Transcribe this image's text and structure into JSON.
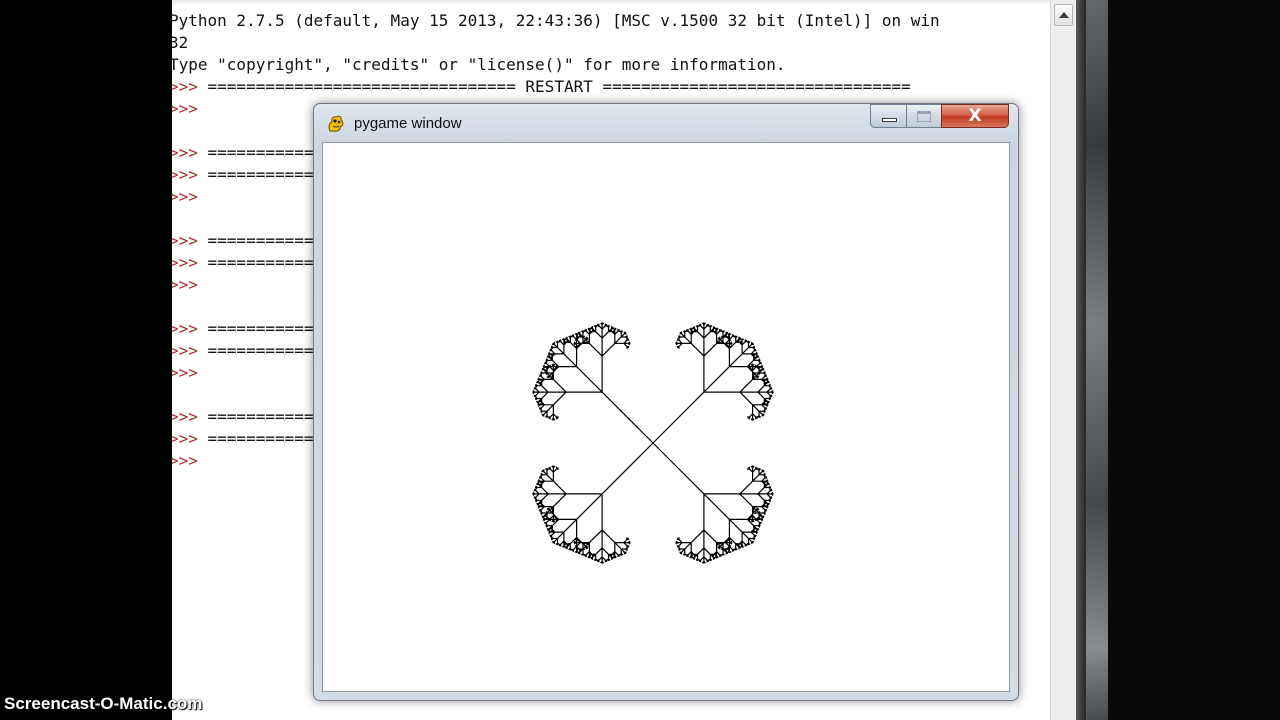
{
  "shell": {
    "lines": [
      {
        "kind": "out",
        "text": "Python 2.7.5 (default, May 15 2013, 22:43:36) [MSC v.1500 32 bit (Intel)] on win"
      },
      {
        "kind": "out",
        "text": "32"
      },
      {
        "kind": "out",
        "text": "Type \"copyright\", \"credits\" or \"license()\" for more information."
      },
      {
        "kind": "prompt",
        "prompt": ">>> ",
        "text": "================================ RESTART ================================"
      },
      {
        "kind": "prompt",
        "prompt": ">>> ",
        "text": ""
      },
      {
        "kind": "blank",
        "text": ""
      },
      {
        "kind": "prompt",
        "prompt": ">>> ",
        "text": "================================ RESTART ================================"
      },
      {
        "kind": "prompt",
        "prompt": ">>> ",
        "text": "================================ RESTART ================================"
      },
      {
        "kind": "prompt",
        "prompt": ">>> ",
        "text": ""
      },
      {
        "kind": "blank",
        "text": ""
      },
      {
        "kind": "prompt",
        "prompt": ">>> ",
        "text": "================================ RESTART ================================"
      },
      {
        "kind": "prompt",
        "prompt": ">>> ",
        "text": "================================ RESTART ================================"
      },
      {
        "kind": "prompt",
        "prompt": ">>> ",
        "text": ""
      },
      {
        "kind": "blank",
        "text": ""
      },
      {
        "kind": "prompt",
        "prompt": ">>> ",
        "text": "================================ RESTART ================================"
      },
      {
        "kind": "prompt",
        "prompt": ">>> ",
        "text": "================================ RESTART ================================"
      },
      {
        "kind": "prompt",
        "prompt": ">>> ",
        "text": ""
      },
      {
        "kind": "blank",
        "text": ""
      },
      {
        "kind": "prompt",
        "prompt": ">>> ",
        "text": "================================ RESTART ================================"
      },
      {
        "kind": "prompt",
        "prompt": ">>> ",
        "text": "================================ RESTART ================================"
      },
      {
        "kind": "prompt",
        "prompt": ">>> ",
        "text": ""
      }
    ]
  },
  "pygame_window": {
    "title": "pygame window",
    "icon": "pygame-snake-icon",
    "close_glyph": "X"
  },
  "fractal": {
    "stroke_color": "#000000",
    "depth": 5,
    "branch_angle_deg": 45,
    "scale_factor": 0.5
  },
  "watermark": "Screencast-O-Matic.com"
}
